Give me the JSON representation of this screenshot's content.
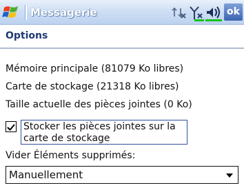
{
  "titlebar": {
    "app_title": "Messagerie",
    "ok_label": "ok",
    "icons": [
      "windows-start-icon",
      "connectivity-icon",
      "signal-icon",
      "volume-icon"
    ]
  },
  "section": {
    "title": "Options"
  },
  "info": {
    "main_memory": "Mémoire principale (81079 Ko libres)",
    "storage_card": "Carte de stockage (21318 Ko libres)",
    "attachments_size": "Taille actuelle des pièces jointes (0 Ko)"
  },
  "store_attachments": {
    "label": "Stocker les pièces jointes sur la carte de stockage",
    "checked": true
  },
  "empty_deleted": {
    "label": "Vider Éléments supprimés:",
    "value": "Manuellement"
  },
  "colors": {
    "titlebar": "#cfdff4",
    "section_title": "#1c3a74",
    "ok_button": "#3d64b3"
  }
}
